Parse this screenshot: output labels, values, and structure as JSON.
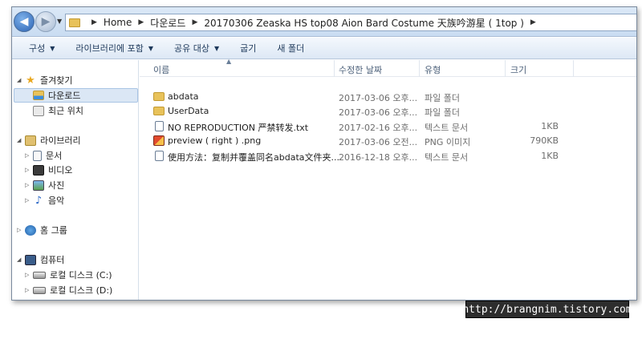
{
  "address": {
    "crumbs": [
      "Home",
      "다운로드",
      "20170306 Zeaska HS top08 Aion Bard Costume 天族吟游星 ( 1top )"
    ]
  },
  "toolbar": {
    "organize": "구성",
    "include_library": "라이브러리에 포함",
    "share": "공유 대상",
    "burn": "굽기",
    "new_folder": "새 폴더"
  },
  "nav": {
    "favorites": "즐겨찾기",
    "downloads": "다운로드",
    "recent": "최근 위치",
    "libraries": "라이브러리",
    "documents": "문서",
    "videos": "비디오",
    "pictures": "사진",
    "music": "음악",
    "homegroup": "홈 그룹",
    "computer": "컴퓨터",
    "disk_c": "로컬 디스크 (C:)",
    "disk_d": "로컬 디스크 (D:)"
  },
  "columns": {
    "name": "이름",
    "modified": "수정한 날짜",
    "type": "유형",
    "size": "크기"
  },
  "files": [
    {
      "name": "abdata",
      "modified": "2017-03-06 오후...",
      "type": "파일 폴더",
      "size": "",
      "icon": "folder-icon"
    },
    {
      "name": "UserData",
      "modified": "2017-03-06 오후...",
      "type": "파일 폴더",
      "size": "",
      "icon": "folder-icon"
    },
    {
      "name": "NO REPRODUCTION 严禁转发.txt",
      "modified": "2017-02-16 오후...",
      "type": "텍스트 문서",
      "size": "1KB",
      "icon": "text-file-icon"
    },
    {
      "name": "preview ( right ) .png",
      "modified": "2017-03-06 오전...",
      "type": "PNG 이미지",
      "size": "790KB",
      "icon": "image-file-icon"
    },
    {
      "name": "使用方法：复制并覆盖同名abdata文件夹...",
      "modified": "2016-12-18 오후...",
      "type": "텍스트 문서",
      "size": "1KB",
      "icon": "text-file-icon"
    }
  ],
  "watermark": "http://brangnim.tistory.com"
}
